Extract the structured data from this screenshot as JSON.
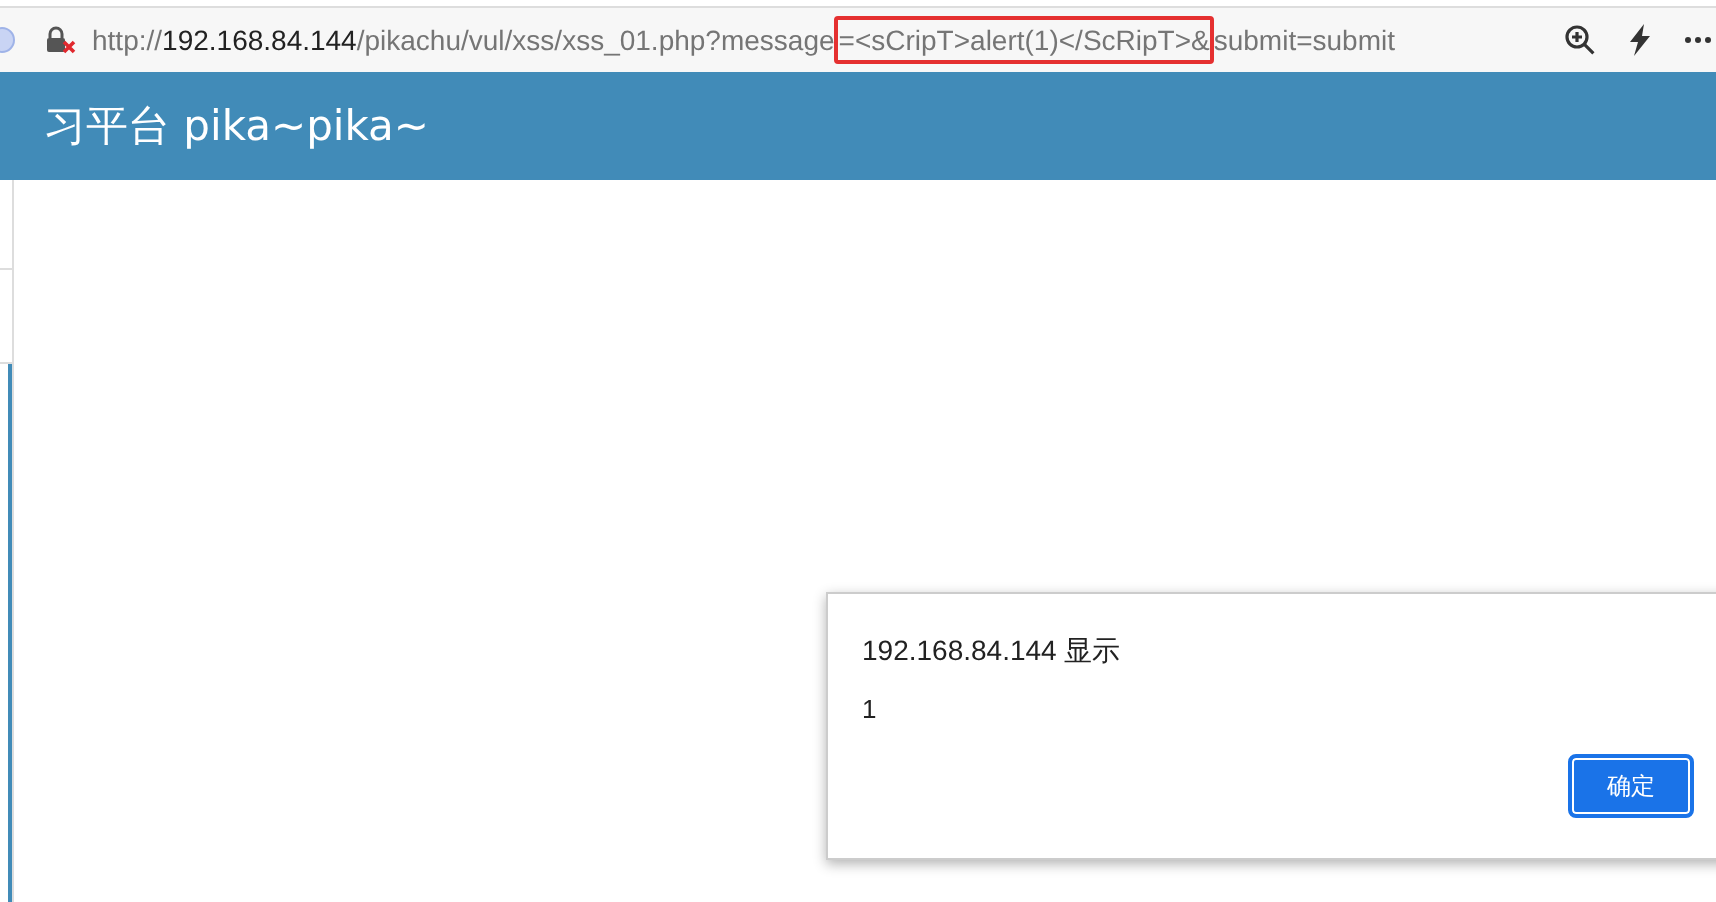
{
  "address_bar": {
    "segments": [
      {
        "kind": "plain",
        "text": "http://"
      },
      {
        "kind": "host",
        "text": "192.168.84.144"
      },
      {
        "kind": "plain",
        "text": "/pikachu/vul/xss/xss_01.php?message"
      },
      {
        "kind": "highlighted",
        "text": "=<sCripT>alert(1)</ScRipT>&"
      },
      {
        "kind": "plain",
        "text": "submit=submit"
      }
    ]
  },
  "header": {
    "title": "习平台 pika~pika~"
  },
  "dialog": {
    "title": "192.168.84.144 显示",
    "message": "1",
    "buttons": [
      {
        "label": "确定",
        "selected": true
      }
    ]
  }
}
